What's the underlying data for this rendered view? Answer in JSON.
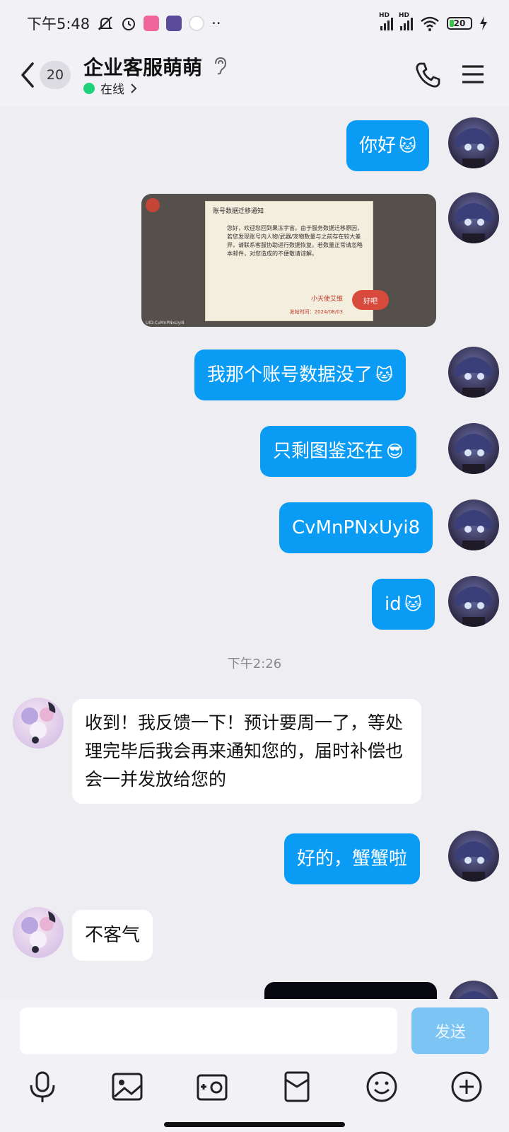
{
  "status_bar": {
    "time": "下午5:48",
    "signal1": "HD",
    "signal2": "HD",
    "battery": "20",
    "more": "··"
  },
  "header": {
    "unread_count": "20",
    "title": "企业客服萌萌",
    "status": "在线"
  },
  "messages": {
    "m1": "你好",
    "m3": "我那个账号数据没了",
    "m4": "只剩图鉴还在",
    "m5": "CvMnPNxUyi8",
    "m6": "id",
    "timestamp": "下午2:26",
    "r1": "收到！我反馈一下！预计要周一了，等处理完毕后我会再来通知您的，届时补偿也会一并发放给您的",
    "m7": "好的，蟹蟹啦",
    "r2": "不客气"
  },
  "image_msg": {
    "title": "账号数据迁移通知",
    "body": "您好，欢迎您回到果冻宇宙。由于服务数据迁移原因，若您发现账号内人物/武器/宠物数量与之前存在较大差异，请联系客服协助进行数据恢复。若数量正常请忽略本邮件，对您造成的不便敬请谅解。",
    "sign": "小天使艾维",
    "date": "发帖时间：2024/08/03",
    "ok": "好吧",
    "uid": "UID:CvMnPNxUyi8"
  },
  "emojis": {
    "cat": "🐱",
    "sunglasses": "😎"
  },
  "input": {
    "placeholder": "",
    "send": "发送"
  },
  "colors": {
    "my_bubble": "#0A9CF5",
    "their_bubble": "#FFFFFF",
    "online": "#1ED27A",
    "send_button": "#7CC4F4"
  }
}
